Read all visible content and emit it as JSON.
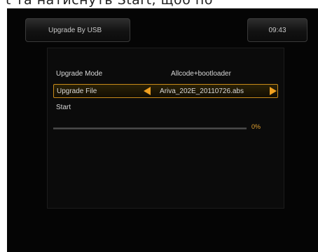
{
  "caption": {
    "text": "t та натиснуть Start, щоб по"
  },
  "header": {
    "title": "Upgrade By USB",
    "clock": "09:43"
  },
  "menu": {
    "upgrade_mode": {
      "label": "Upgrade Mode",
      "value": "Allcode+bootloader"
    },
    "upgrade_file": {
      "label": "Upgrade File",
      "value": "Ariva_202E_20110726.abs"
    },
    "start": {
      "label": "Start"
    }
  },
  "progress": {
    "percent_label": "0%",
    "fraction": 0
  },
  "icons": {
    "left": "arrow-left-icon",
    "right": "arrow-right-icon"
  },
  "colors": {
    "accent": "#f0a020",
    "selection_border": "#c88a1a",
    "background": "#050505"
  }
}
